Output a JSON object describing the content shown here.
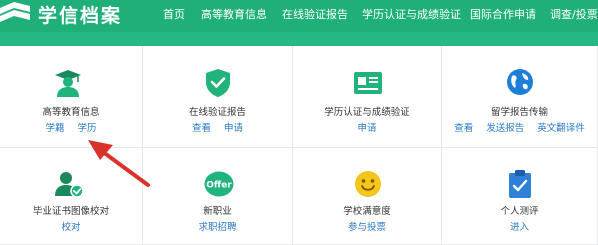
{
  "app": {
    "logo_text": "学信档案",
    "logo_icon": "book-logo-icon"
  },
  "nav": [
    "首页",
    "高等教育信息",
    "在线验证报告",
    "学历认证与成绩验证",
    "国际合作申请",
    "调查/投票"
  ],
  "cards": [
    {
      "title": "高等教育信息",
      "icon": "graduate-icon",
      "links": [
        "学籍",
        "学历"
      ]
    },
    {
      "title": "在线验证报告",
      "icon": "shield-check-icon",
      "links": [
        "查看",
        "申请"
      ]
    },
    {
      "title": "学历认证与成绩验证",
      "icon": "id-card-icon",
      "links": [
        "申请"
      ]
    },
    {
      "title": "留学报告传输",
      "icon": "globe-icon",
      "links": [
        "查看",
        "发送报告",
        "英文翻译件"
      ]
    },
    {
      "title": "毕业证书图像校对",
      "icon": "user-check-icon",
      "links": [
        "校对"
      ]
    },
    {
      "title": "新职业",
      "icon": "offer-icon",
      "icon_text": "Offer",
      "links": [
        "求职招聘"
      ]
    },
    {
      "title": "学校满意度",
      "icon": "smiley-icon",
      "links": [
        "参与投票"
      ]
    },
    {
      "title": "个人测评",
      "icon": "clipboard-check-icon",
      "links": [
        "进入"
      ]
    }
  ],
  "colors": {
    "header": "#1fb07a",
    "accent_green": "#20b37b",
    "link": "#2a79c8",
    "arrow": "#d9322b",
    "globe": "#1e7fd8",
    "smiley": "#f5c518",
    "clipboard": "#2e7fd6"
  },
  "annotation": {
    "type": "red-arrow",
    "target": "学历"
  }
}
